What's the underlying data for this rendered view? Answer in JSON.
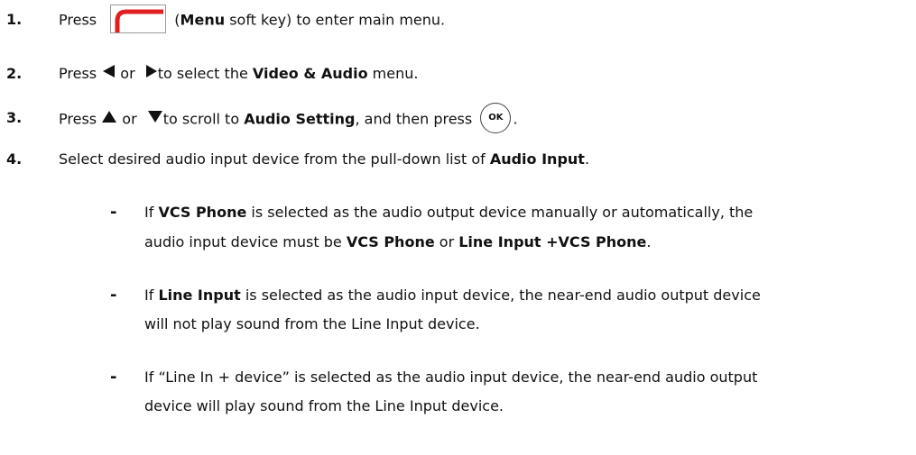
{
  "steps": [
    {
      "num": "1.",
      "pre": "Press",
      "key_open": "(",
      "bold": "Menu",
      "post": " soft key) to enter main menu."
    },
    {
      "num": "2.",
      "pre": "Press",
      "or": "or",
      "mid": "to select the ",
      "bold": "Video & Audio",
      "post": " menu."
    },
    {
      "num": "3.",
      "pre": "Press",
      "or": "or",
      "mid": "to scroll to ",
      "bold": "Audio Setting",
      "post": ", and then press",
      "ok_label": "OK",
      "end": "."
    },
    {
      "num": "4.",
      "pre": "Select desired audio input device from the pull-down list of ",
      "bold": "Audio Input",
      "post": "."
    }
  ],
  "bullets": [
    {
      "dash": "-",
      "line1": {
        "t1": "If ",
        "b1": "VCS Phone",
        "t2": " is selected as the audio output device manually or automatically, the"
      },
      "line2": {
        "t1": "audio input device must be ",
        "b1": "VCS Phone",
        "t2": " or ",
        "b2": "Line Input +VCS Phone",
        "t3": "."
      }
    },
    {
      "dash": "-",
      "line1": {
        "t1": "If ",
        "b1": "Line Input",
        "t2": " is selected as the audio input device, the near-end audio output device"
      },
      "line2": {
        "t1": "will not play sound from the Line Input device."
      }
    },
    {
      "dash": "-",
      "line1": {
        "t1": "If “Line In + device” is selected as the audio input device, the near-end audio output"
      },
      "line2": {
        "t1": "device will play sound from the Line Input device."
      }
    }
  ],
  "icons": {
    "menu_key_color": "#e02020",
    "arrow_color": "#111111"
  }
}
